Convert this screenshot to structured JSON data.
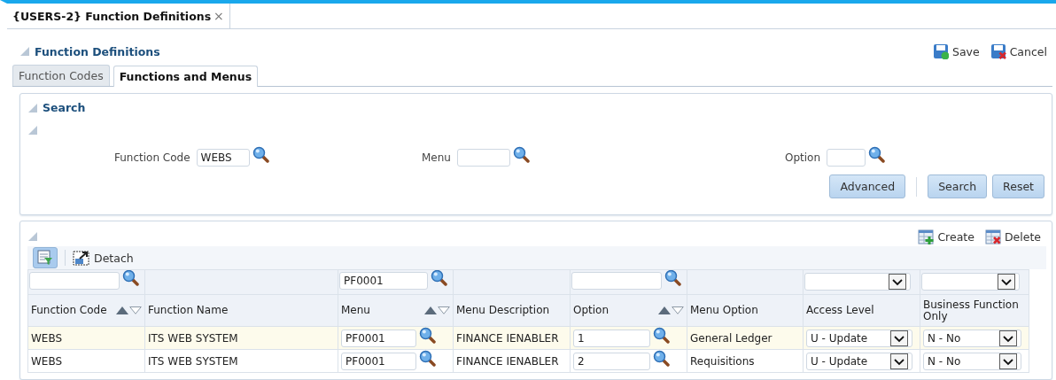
{
  "document_tab": {
    "title": "{USERS-2} Function Definitions",
    "close": "×"
  },
  "header": {
    "title": "Function Definitions",
    "actions": [
      {
        "kind": "save",
        "label": "Save"
      },
      {
        "kind": "cancel",
        "label": "Cancel"
      }
    ]
  },
  "tabs": [
    {
      "label": "Function Codes",
      "selected": false
    },
    {
      "label": "Functions and Menus",
      "selected": true
    }
  ],
  "search": {
    "title": "Search",
    "fields": [
      {
        "label": "Function Code",
        "value": "WEBS"
      },
      {
        "label": "Menu"
      },
      {
        "label": "Option"
      }
    ],
    "buttons": [
      "Advanced",
      "Search",
      "Reset"
    ]
  },
  "table_toolbar": {
    "actions": [
      {
        "kind": "create",
        "label": "Create"
      },
      {
        "kind": "delete",
        "label": "Delete"
      }
    ],
    "detach": "Detach"
  },
  "table": {
    "columns": [
      {
        "label": "Function Code",
        "sortable": true,
        "filter": {
          "kind": "lookup"
        }
      },
      {
        "label": "Function Name",
        "sortable": false,
        "filter": {
          "kind": "none"
        }
      },
      {
        "label": "Menu",
        "sortable": true,
        "filter": {
          "kind": "lookup",
          "value": "PF0001"
        }
      },
      {
        "label": "Menu Description",
        "sortable": false,
        "filter": {
          "kind": "none"
        }
      },
      {
        "label": "Option",
        "sortable": true,
        "filter": {
          "kind": "lookup"
        }
      },
      {
        "label": "Menu Option",
        "sortable": false,
        "filter": {
          "kind": "none"
        }
      },
      {
        "label": "Access Level",
        "sortable": false,
        "filter": {
          "kind": "select"
        }
      },
      {
        "label": "Business Function Only",
        "sortable": false,
        "filter": {
          "kind": "select"
        }
      }
    ],
    "rows": [
      {
        "selected": true,
        "cells": [
          {
            "kind": "text",
            "value": "WEBS"
          },
          {
            "kind": "text",
            "value": "ITS WEB SYSTEM"
          },
          {
            "kind": "lookup",
            "value": "PF0001"
          },
          {
            "kind": "text",
            "value": "FINANCE IENABLER"
          },
          {
            "kind": "lookup",
            "value": "1"
          },
          {
            "kind": "text",
            "value": "General Ledger"
          },
          {
            "kind": "select",
            "value": "U - Update"
          },
          {
            "kind": "select",
            "value": "N - No"
          }
        ]
      },
      {
        "selected": false,
        "cells": [
          {
            "kind": "text",
            "value": "WEBS"
          },
          {
            "kind": "text",
            "value": "ITS WEB SYSTEM"
          },
          {
            "kind": "lookup",
            "value": "PF0001"
          },
          {
            "kind": "text",
            "value": "FINANCE IENABLER"
          },
          {
            "kind": "lookup",
            "value": "2"
          },
          {
            "kind": "text",
            "value": "Requisitions"
          },
          {
            "kind": "select",
            "value": "U - Update"
          },
          {
            "kind": "select",
            "value": "N - No"
          }
        ]
      }
    ]
  }
}
